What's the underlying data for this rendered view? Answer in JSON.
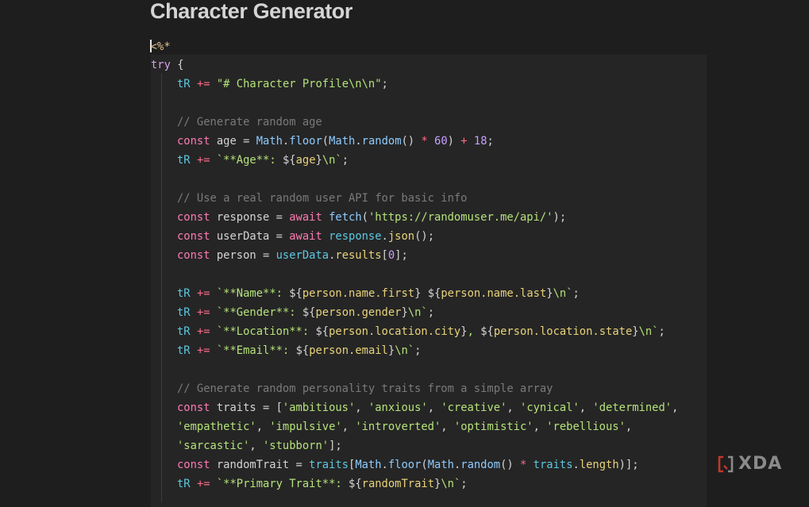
{
  "page": {
    "title": "Character Generator"
  },
  "opener": "<%*",
  "code_lines": [
    {
      "indent": false,
      "tokens": [
        [
          "ctl",
          "try"
        ],
        [
          "pun",
          " {"
        ]
      ]
    },
    {
      "indent": true,
      "tokens": [
        [
          "var",
          "tR"
        ],
        [
          "pun",
          " "
        ],
        [
          "op",
          "+="
        ],
        [
          "pun",
          " "
        ],
        [
          "str",
          "\"# Character Profile\\n\\n\""
        ],
        [
          "pun",
          ";"
        ]
      ]
    },
    {
      "indent": true,
      "tokens": []
    },
    {
      "indent": true,
      "tokens": [
        [
          "cmt",
          "// Generate random age"
        ]
      ]
    },
    {
      "indent": true,
      "tokens": [
        [
          "kw",
          "const"
        ],
        [
          "pun",
          " age = "
        ],
        [
          "fn",
          "Math"
        ],
        [
          "pun",
          "."
        ],
        [
          "fn",
          "floor"
        ],
        [
          "pun",
          "("
        ],
        [
          "fn",
          "Math"
        ],
        [
          "pun",
          "."
        ],
        [
          "fn",
          "random"
        ],
        [
          "pun",
          "() "
        ],
        [
          "op",
          "*"
        ],
        [
          "pun",
          " "
        ],
        [
          "num",
          "60"
        ],
        [
          "pun",
          ") "
        ],
        [
          "op",
          "+"
        ],
        [
          "pun",
          " "
        ],
        [
          "num",
          "18"
        ],
        [
          "pun",
          ";"
        ]
      ]
    },
    {
      "indent": true,
      "tokens": [
        [
          "var",
          "tR"
        ],
        [
          "pun",
          " "
        ],
        [
          "op",
          "+="
        ],
        [
          "pun",
          " "
        ],
        [
          "str",
          "`**Age**: "
        ],
        [
          "pun",
          "${"
        ],
        [
          "prop",
          "age"
        ],
        [
          "pun",
          "}"
        ],
        [
          "str",
          "\\n`"
        ],
        [
          "pun",
          ";"
        ]
      ]
    },
    {
      "indent": true,
      "tokens": []
    },
    {
      "indent": true,
      "tokens": [
        [
          "cmt",
          "// Use a real random user API for basic info"
        ]
      ]
    },
    {
      "indent": true,
      "tokens": [
        [
          "kw",
          "const"
        ],
        [
          "pun",
          " response = "
        ],
        [
          "kw",
          "await"
        ],
        [
          "pun",
          " "
        ],
        [
          "fn",
          "fetch"
        ],
        [
          "pun",
          "("
        ],
        [
          "str",
          "'https://randomuser.me/api/'"
        ],
        [
          "pun",
          ");"
        ]
      ]
    },
    {
      "indent": true,
      "tokens": [
        [
          "kw",
          "const"
        ],
        [
          "pun",
          " userData = "
        ],
        [
          "kw",
          "await"
        ],
        [
          "pun",
          " "
        ],
        [
          "var",
          "response"
        ],
        [
          "pun",
          "."
        ],
        [
          "prop",
          "json"
        ],
        [
          "pun",
          "();"
        ]
      ]
    },
    {
      "indent": true,
      "tokens": [
        [
          "kw",
          "const"
        ],
        [
          "pun",
          " person = "
        ],
        [
          "var",
          "userData"
        ],
        [
          "pun",
          "."
        ],
        [
          "prop",
          "results"
        ],
        [
          "pun",
          "["
        ],
        [
          "num",
          "0"
        ],
        [
          "pun",
          "];"
        ]
      ]
    },
    {
      "indent": true,
      "tokens": []
    },
    {
      "indent": true,
      "tokens": [
        [
          "var",
          "tR"
        ],
        [
          "pun",
          " "
        ],
        [
          "op",
          "+="
        ],
        [
          "pun",
          " "
        ],
        [
          "str",
          "`**Name**: "
        ],
        [
          "pun",
          "${"
        ],
        [
          "prop",
          "person.name.first"
        ],
        [
          "pun",
          "}"
        ],
        [
          "str",
          " "
        ],
        [
          "pun",
          "${"
        ],
        [
          "prop",
          "person.name.last"
        ],
        [
          "pun",
          "}"
        ],
        [
          "str",
          "\\n`"
        ],
        [
          "pun",
          ";"
        ]
      ]
    },
    {
      "indent": true,
      "tokens": [
        [
          "var",
          "tR"
        ],
        [
          "pun",
          " "
        ],
        [
          "op",
          "+="
        ],
        [
          "pun",
          " "
        ],
        [
          "str",
          "`**Gender**: "
        ],
        [
          "pun",
          "${"
        ],
        [
          "prop",
          "person.gender"
        ],
        [
          "pun",
          "}"
        ],
        [
          "str",
          "\\n`"
        ],
        [
          "pun",
          ";"
        ]
      ]
    },
    {
      "indent": true,
      "tokens": [
        [
          "var",
          "tR"
        ],
        [
          "pun",
          " "
        ],
        [
          "op",
          "+="
        ],
        [
          "pun",
          " "
        ],
        [
          "str",
          "`**Location**: "
        ],
        [
          "pun",
          "${"
        ],
        [
          "prop",
          "person.location.city"
        ],
        [
          "pun",
          "}"
        ],
        [
          "str",
          ", "
        ],
        [
          "pun",
          "${"
        ],
        [
          "prop",
          "person.location.state"
        ],
        [
          "pun",
          "}"
        ],
        [
          "str",
          "\\n`"
        ],
        [
          "pun",
          ";"
        ]
      ]
    },
    {
      "indent": true,
      "tokens": [
        [
          "var",
          "tR"
        ],
        [
          "pun",
          " "
        ],
        [
          "op",
          "+="
        ],
        [
          "pun",
          " "
        ],
        [
          "str",
          "`**Email**: "
        ],
        [
          "pun",
          "${"
        ],
        [
          "prop",
          "person.email"
        ],
        [
          "pun",
          "}"
        ],
        [
          "str",
          "\\n`"
        ],
        [
          "pun",
          ";"
        ]
      ]
    },
    {
      "indent": true,
      "tokens": []
    },
    {
      "indent": true,
      "tokens": [
        [
          "cmt",
          "// Generate random personality traits from a simple array"
        ]
      ]
    },
    {
      "indent": true,
      "tokens": [
        [
          "kw",
          "const"
        ],
        [
          "pun",
          " traits = ["
        ],
        [
          "str",
          "'ambitious'"
        ],
        [
          "pun",
          ", "
        ],
        [
          "str",
          "'anxious'"
        ],
        [
          "pun",
          ", "
        ],
        [
          "str",
          "'creative'"
        ],
        [
          "pun",
          ", "
        ],
        [
          "str",
          "'cynical'"
        ],
        [
          "pun",
          ", "
        ],
        [
          "str",
          "'determined'"
        ],
        [
          "pun",
          ","
        ]
      ]
    },
    {
      "indent": true,
      "tokens": [
        [
          "str",
          "'empathetic'"
        ],
        [
          "pun",
          ", "
        ],
        [
          "str",
          "'impulsive'"
        ],
        [
          "pun",
          ", "
        ],
        [
          "str",
          "'introverted'"
        ],
        [
          "pun",
          ", "
        ],
        [
          "str",
          "'optimistic'"
        ],
        [
          "pun",
          ", "
        ],
        [
          "str",
          "'rebellious'"
        ],
        [
          "pun",
          ","
        ]
      ]
    },
    {
      "indent": true,
      "tokens": [
        [
          "str",
          "'sarcastic'"
        ],
        [
          "pun",
          ", "
        ],
        [
          "str",
          "'stubborn'"
        ],
        [
          "pun",
          "];"
        ]
      ]
    },
    {
      "indent": true,
      "tokens": [
        [
          "kw",
          "const"
        ],
        [
          "pun",
          " randomTrait = "
        ],
        [
          "var",
          "traits"
        ],
        [
          "pun",
          "["
        ],
        [
          "fn",
          "Math"
        ],
        [
          "pun",
          "."
        ],
        [
          "fn",
          "floor"
        ],
        [
          "pun",
          "("
        ],
        [
          "fn",
          "Math"
        ],
        [
          "pun",
          "."
        ],
        [
          "fn",
          "random"
        ],
        [
          "pun",
          "() "
        ],
        [
          "op",
          "*"
        ],
        [
          "pun",
          " "
        ],
        [
          "var",
          "traits"
        ],
        [
          "pun",
          "."
        ],
        [
          "prop",
          "length"
        ],
        [
          "pun",
          ")];"
        ]
      ]
    },
    {
      "indent": true,
      "tokens": [
        [
          "var",
          "tR"
        ],
        [
          "pun",
          " "
        ],
        [
          "op",
          "+="
        ],
        [
          "pun",
          " "
        ],
        [
          "str",
          "`**Primary Trait**: "
        ],
        [
          "pun",
          "${"
        ],
        [
          "prop",
          "randomTrait"
        ],
        [
          "pun",
          "}"
        ],
        [
          "str",
          "\\n`"
        ],
        [
          "pun",
          ";"
        ]
      ]
    }
  ],
  "watermark": {
    "text": "XDA",
    "icon": "xda-bracket-logo"
  },
  "colors": {
    "background": "#1e1e1e",
    "code_block": "#252525",
    "keyword": "#ff7ab2",
    "string": "#b5e27a",
    "number": "#c8a0ff",
    "comment": "#7a7a7a"
  }
}
